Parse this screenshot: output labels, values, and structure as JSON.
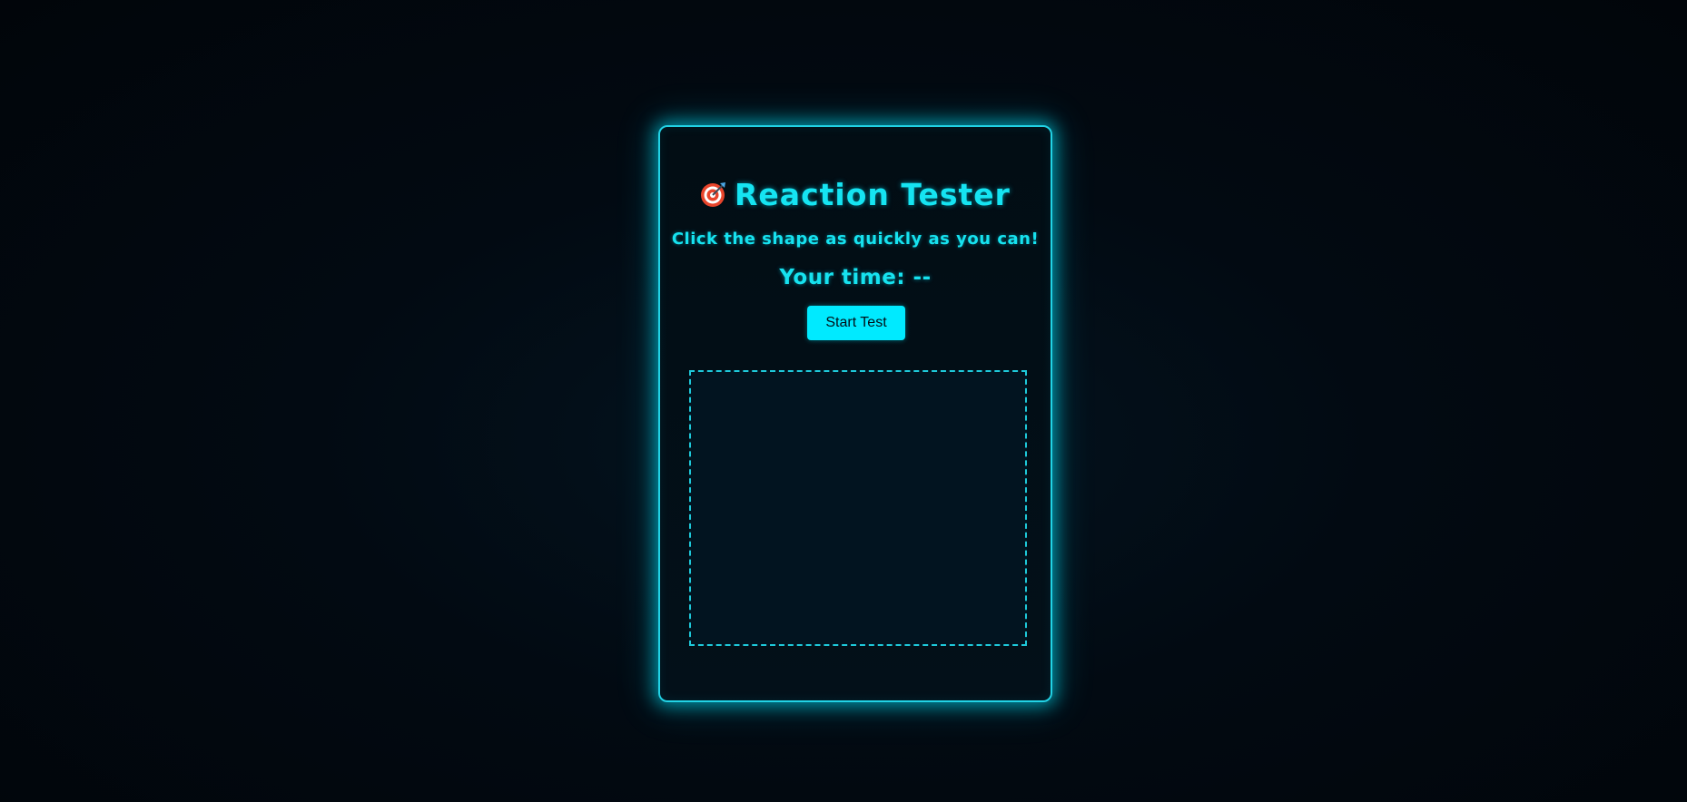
{
  "app": {
    "title": "Reaction Tester",
    "title_icon": "direct-hit-target-icon",
    "subtitle": "Click the shape as quickly as you can!",
    "time_display": "Your time: --",
    "start_button_label": "Start Test"
  },
  "colors": {
    "accent": "#00eaff",
    "text": "#15e4f2",
    "card_border": "#22d3e6",
    "background": "#01050a"
  }
}
